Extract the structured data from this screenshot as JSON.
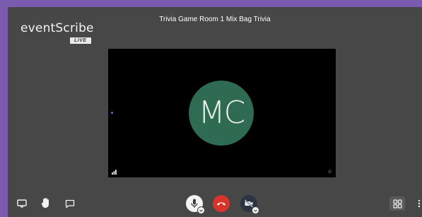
{
  "colors": {
    "frame": "#7b5bb0",
    "background": "#474747",
    "stage": "#000000",
    "avatar": "#2e6b52",
    "hangup": "#d9342b",
    "video_button": "#2b3440"
  },
  "brand": {
    "name": "eventScribe",
    "badge": "LIVE"
  },
  "meeting": {
    "title": "Trivia Game Room 1 Mix Bag Trivia"
  },
  "participant": {
    "initials": "MC"
  },
  "toolbar": {
    "left": [
      {
        "icon": "screen-share-icon"
      },
      {
        "icon": "raise-hand-icon"
      },
      {
        "icon": "chat-icon"
      }
    ],
    "center": [
      {
        "icon": "microphone-icon"
      },
      {
        "icon": "hang-up-icon"
      },
      {
        "icon": "camera-off-icon"
      }
    ],
    "right": [
      {
        "icon": "tile-view-icon"
      },
      {
        "icon": "more-options-icon"
      }
    ]
  }
}
